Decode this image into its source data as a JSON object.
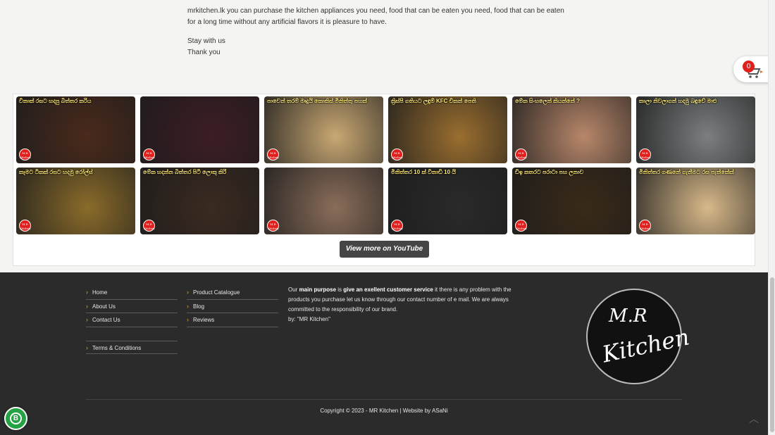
{
  "intro": {
    "line1": "mrkitchen.lk  you can purchase the kitchen appliances you need, food that can be eaten you need, food that can be eaten",
    "line2": "for a long time without any artificial flavors it is pleasure to have.",
    "stay": "Stay with us",
    "thanks": "Thank you"
  },
  "cart": {
    "count": "0",
    "icon": "shopping-cart-icon"
  },
  "videos": {
    "thumbs": [
      {
        "caption": "විනාක් රසට හදපු බිත්තර කරිය",
        "color": "#4a2a1c"
      },
      {
        "caption": "",
        "color": "#3d1d25"
      },
      {
        "caption": "පාවෙන් තරම් මෘදුයි කොකිස් මිනිත්තු පහක්",
        "color": "#c9a873"
      },
      {
        "caption": "ක්‍රිස්පි ගතියට ලඳුම් KFC චිකන් පෙති",
        "color": "#9a6e2f"
      },
      {
        "caption": "මේක සිංහලෙන් කියන්නේ ?",
        "color": "#b8876a"
      },
      {
        "caption": "කාලා නිවලාගන් හදමු බඳුවේ මාළු",
        "color": "#7b7f80"
      },
      {
        "caption": "කෑමට ටිකක් රසට හදමු රෝල්ස්",
        "color": "#8a6b2a"
      },
      {
        "caption": "මේක හදන්න බිත්තර පිටි ලොකු කිරි",
        "color": "#3b2a20"
      },
      {
        "caption": "",
        "color": "#8a6d5a"
      },
      {
        "caption": "මිනිත්තර 10 ක් විනාඩි 10 යි",
        "color": "#2a2a2a"
      },
      {
        "caption": "ඩිඉ කතරට පරාටා පහ ලනාව",
        "color": "#3a2a18"
      },
      {
        "caption": "මිනිත්තර ගණනේ ගැනීමට රස පැන්කේක්",
        "color": "#d8b98a"
      }
    ],
    "button": "View more on YouTube"
  },
  "footer": {
    "col1": [
      "Home",
      "About Us",
      "Contact Us"
    ],
    "col1b": "Terms & Conditions",
    "col2": [
      "Product Catalogue",
      "Blog",
      "Reviews"
    ],
    "about": {
      "p1": "Our ",
      "b1": "main purpose",
      "p2": " is ",
      "b2": "give an exellent customer service",
      "p3": " it there is any problem with the products you purchase let us know through our contact number of e mail. We are always committed to the responsibility of our brand.",
      "by": "by: \"MR Kitchen\""
    },
    "brand": {
      "line1": "M.R",
      "line2": "Kitchen"
    },
    "copyright": "Copyright © 2023 - MR Kitchen  |  Website by ASaNi"
  }
}
